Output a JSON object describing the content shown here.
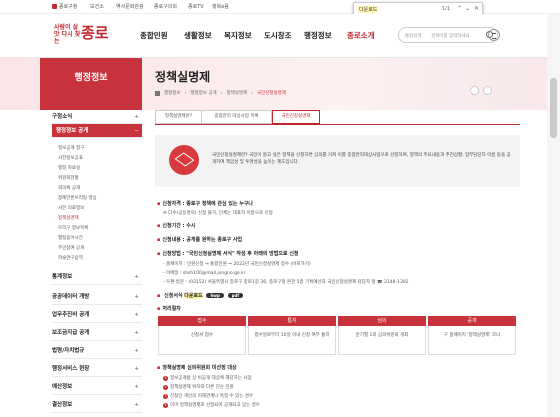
{
  "util": {
    "home": "종로구청",
    "links": [
      "보건소",
      "역사문화관광",
      "종로구의회",
      "종로TV",
      "행복e음"
    ]
  },
  "findbar": {
    "query": "다운로드",
    "count": "1/1"
  },
  "header": {
    "logo_small": "사람이 살맛 다시 찾는",
    "logo_big": "종로",
    "nav": [
      "종합민원",
      "생활정보",
      "복지정보",
      "도시창조",
      "행정정보",
      "종로소개"
    ],
    "search_select": "통합검색",
    "search_placeholder": "검색어를 입력하세요"
  },
  "sidebar": {
    "title": "행정정보",
    "items": [
      "구정소식",
      "행정정보 공개",
      "통계정보",
      "공공데이터 개방",
      "업무추진비 공개",
      "보조금지급 공개",
      "법령/자치법규",
      "행정서비스 현장",
      "예산정보",
      "결산정보"
    ],
    "subs": [
      "정보공개 청구",
      "사전정보공표",
      "행정 자료실",
      "위원회현황",
      "회의록 공개",
      "정례언론브리핑 영상",
      "사전 의료정보",
      "정책실명제",
      "우리구 정보목록",
      "행정용어사전",
      "주민참여 공개",
      "학술연구용역"
    ]
  },
  "page": {
    "title": "정책실명제",
    "breadcrumb": [
      "행정정보",
      "행정정보 공개",
      "정책실명제",
      "국민신청실명제"
    ]
  },
  "tabs": [
    "정책실명제란?",
    "중점관리 대상사업 목록",
    "국민신청실명제"
  ],
  "intro": "국민신청실명제란? 국민이 알고 싶은 정책을 신청하면 심의를 거쳐 이를 중점관리대상사업으로 선정하여, 정책의 주요내용과 추진상황, 업무담당자 이름 등을 공개하여 책임성 및 투명성을 높이는 제도입니다.",
  "sections": {
    "qualify": "신청자격 : 종로구 정책에 관심 있는 누구나",
    "qualify_note": "※ 다수(공동명의) 신청 불가, 단체는 대표자 이름으로 신청",
    "period": "신청기간 : 수시",
    "content": "신청내용 : 공개를 원하는 종로구 사업",
    "method": "신청방법 : \"국민신청실명제 서식\" 작성 후 아래의 방법으로 신청",
    "visit": "- 홈페이지 : 민원신청 ⇒ 통합민원 ⇒ 2022년 국민신청실명제 접수 (바로가기)",
    "email": "- 이메일 : shsh100@mail.jongno.go.kr",
    "post": "- 우편·방문 : (03152) 서울특별시 종로구 종로1길 36, 종로구청 본관 5층 기획예산과 국민신청실명제 담당자 앞 ☎ 2148-1392",
    "form_label": "신청서식",
    "form_download": "다운로드",
    "form_hwp": "hwp",
    "form_pdf": "pdf",
    "proc_label": "처리절차",
    "review": "정책실명제 심의위원회 미선정 대상"
  },
  "process": [
    {
      "head": "접수",
      "body": "신청서 접수"
    },
    {
      "head": "통지",
      "body": "접수일로부터 10일 이내 신청 여부 통지"
    },
    {
      "head": "심의",
      "body": "분기별 1회 심의위원회 개최"
    },
    {
      "head": "공개",
      "body": "구 홈페이지 '정책실명제' 코너"
    }
  ],
  "exclusions": [
    "정보공개법 상 비공개 대상에 해당하는 사업",
    "정책실명제 위치와 다른 단순 민원",
    "신청인 개인의 이해관계나 특정 수 있는 경우",
    "이미 정책실명제로 선정되어 공개되고 있는 경우"
  ]
}
